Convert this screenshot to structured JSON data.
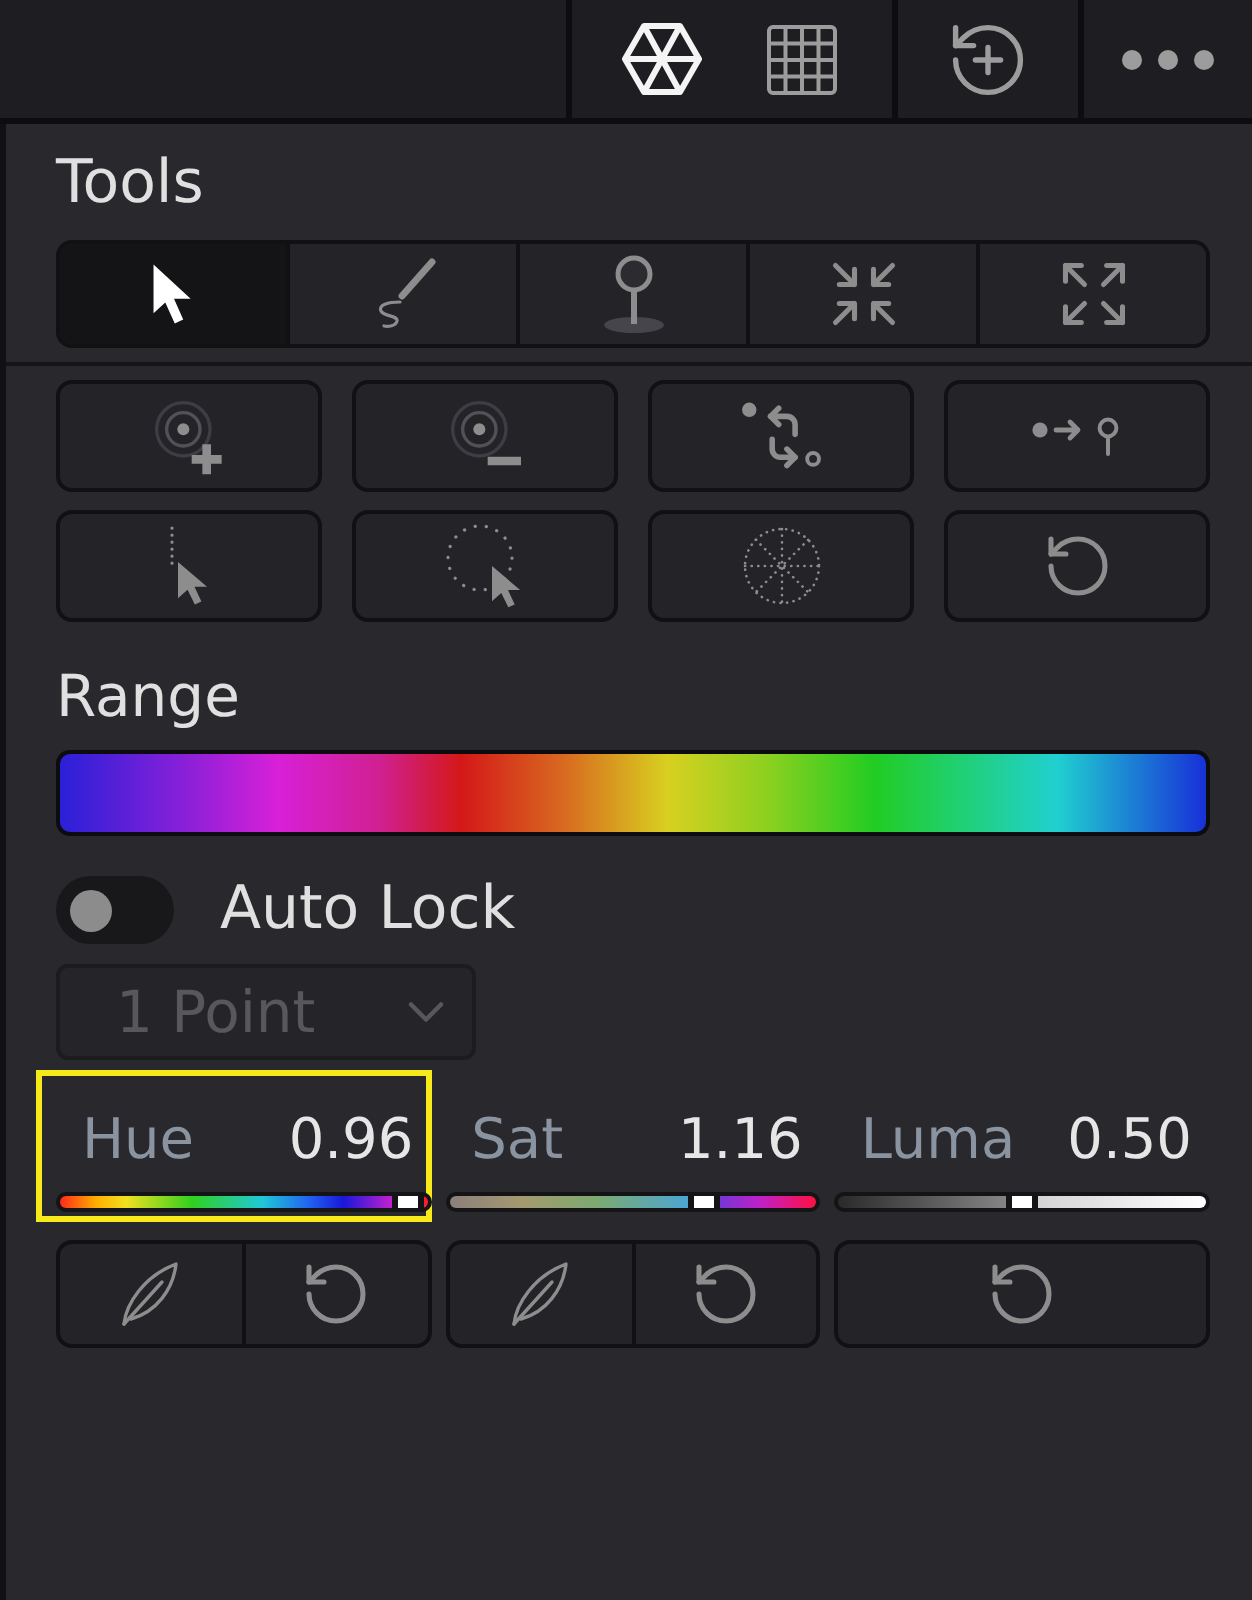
{
  "toolbar": {
    "groups": [
      {
        "buttons": [
          {
            "kind": "hexagon",
            "selected": true
          },
          {
            "kind": "grid",
            "selected": false
          }
        ]
      },
      {
        "buttons": [
          {
            "kind": "history",
            "selected": false
          }
        ]
      },
      {
        "buttons": [
          {
            "kind": "more",
            "selected": false
          }
        ]
      }
    ]
  },
  "tools": {
    "title": "Tools",
    "modes": [
      {
        "kind": "pointer",
        "selected": true
      },
      {
        "kind": "pen",
        "selected": false
      },
      {
        "kind": "pin",
        "selected": false
      },
      {
        "kind": "shrink",
        "selected": false
      },
      {
        "kind": "expand",
        "selected": false
      }
    ],
    "actions": [
      {
        "kind": "add"
      },
      {
        "kind": "remove"
      },
      {
        "kind": "swap"
      },
      {
        "kind": "move"
      },
      {
        "kind": "pick"
      },
      {
        "kind": "lasso"
      },
      {
        "kind": "spokes"
      },
      {
        "kind": "reset"
      }
    ]
  },
  "range": {
    "title": "Range"
  },
  "auto_lock": {
    "label": "Auto Lock",
    "on": false
  },
  "point_mode": {
    "value": "1 Point",
    "disabled": true
  },
  "sliders": [
    {
      "kind": "hue",
      "label": "Hue",
      "value": "0.96",
      "level": 0.94,
      "highlighted": true,
      "actions": [
        {
          "kind": "feather"
        },
        {
          "kind": "reset"
        }
      ]
    },
    {
      "kind": "sat",
      "label": "Sat",
      "value": "1.16",
      "level": 0.69,
      "highlighted": false,
      "actions": [
        {
          "kind": "feather"
        },
        {
          "kind": "reset"
        }
      ]
    },
    {
      "kind": "luma",
      "label": "Luma",
      "value": "0.50",
      "level": 0.5,
      "highlighted": false,
      "actions": [
        {
          "kind": "reset"
        }
      ]
    }
  ]
}
